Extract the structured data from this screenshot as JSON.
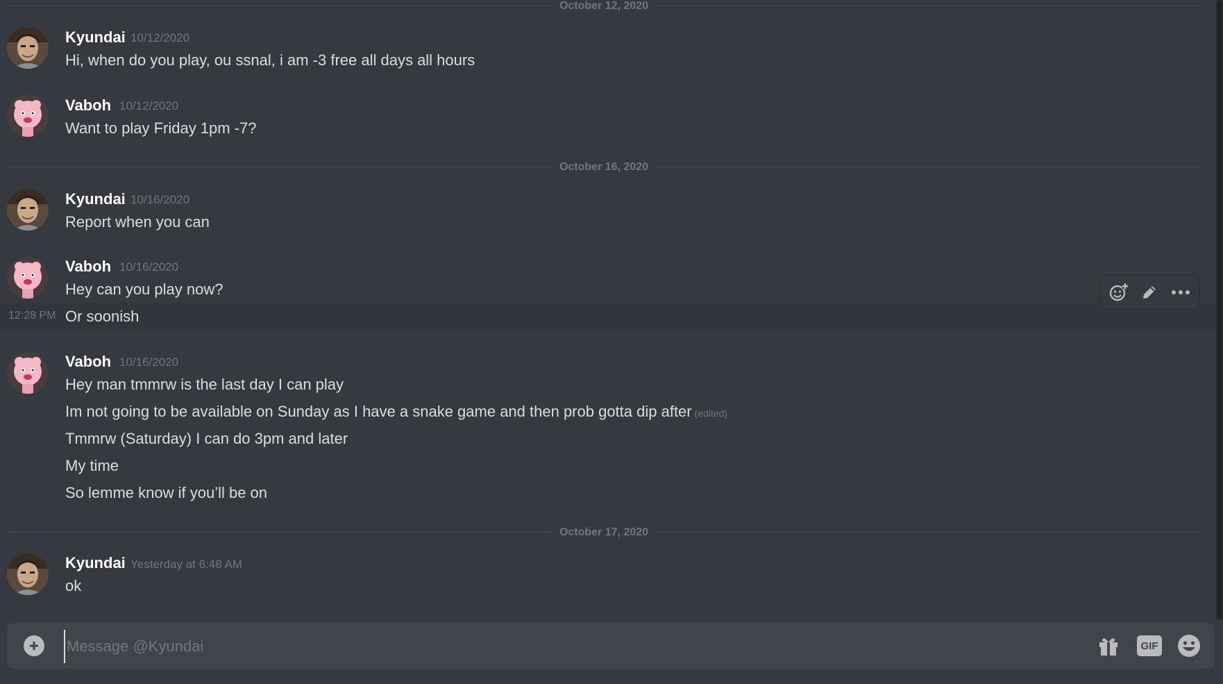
{
  "dividers": [
    {
      "label": "October 12, 2020"
    },
    {
      "label": "October 16, 2020"
    },
    {
      "label": "October 17, 2020"
    }
  ],
  "messages": [
    {
      "author": "Kyundai",
      "time": "10/12/2020",
      "lines": [
        "Hi, when do you play, ou ssnal, i am -3 free all days all hours"
      ]
    },
    {
      "author": "Vaboh",
      "time": "10/12/2020",
      "lines": [
        "Want to play Friday 1pm -7?"
      ]
    },
    {
      "author": "Kyundai",
      "time": "10/16/2020",
      "lines": [
        "Report when you can"
      ]
    },
    {
      "author": "Vaboh",
      "time": "10/16/2020",
      "lines": [
        "Hey can you play now?",
        "Or soonish"
      ],
      "hover_time": "12:28 PM"
    },
    {
      "author": "Vaboh",
      "time": "10/16/2020",
      "lines": [
        "Hey man tmmrw is the last day I can play",
        "Im not going to be available on Sunday as I have a snake game and then prob gotta dip after",
        "Tmmrw (Saturday) I can do 3pm and later",
        "My time",
        "So lemme know if you’ll be on"
      ],
      "edited_label": "(edited)"
    },
    {
      "author": "Kyundai",
      "time": "Yesterday at 6:48 AM",
      "lines": [
        "ok"
      ]
    }
  ],
  "toolbar": {
    "icons": [
      "add-reaction-icon",
      "edit-icon",
      "more-icon"
    ]
  },
  "composer": {
    "placeholder": "Message @Kyundai",
    "value": "",
    "icons": [
      "plus-circle-icon",
      "gift-icon",
      "gif-icon",
      "emoji-icon"
    ],
    "gif_label": "GIF"
  },
  "colors": {
    "background": "#36393f",
    "input": "#40444b",
    "username": "#ffffff",
    "text": "#dcddde",
    "muted": "#72767d"
  }
}
